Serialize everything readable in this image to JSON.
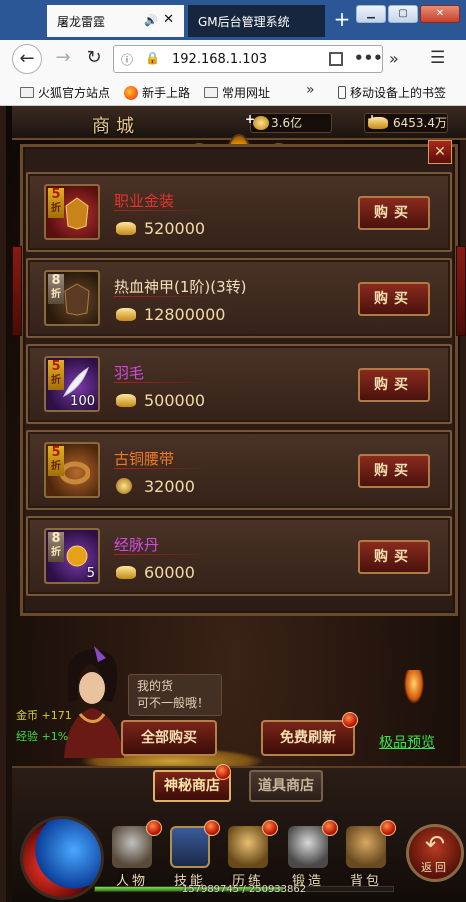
{
  "browser": {
    "tabs": [
      {
        "title": "屠龙雷霆",
        "active": true
      },
      {
        "title": "GM后台管理系统",
        "active": false
      }
    ],
    "url": "192.168.1.103",
    "bookmarks": [
      "火狐官方站点",
      "新手上路",
      "常用网址",
      "移动设备上的书签"
    ]
  },
  "game": {
    "title": "商城",
    "gold_amount": "3.6亿",
    "ingot_amount": "6453.4万",
    "items": [
      {
        "name": "职业金装",
        "price": "520000",
        "discount_num": "5",
        "discount_char": "折",
        "qty": "",
        "name_color": "#e6322a",
        "rarity": "red",
        "currency": "ingot"
      },
      {
        "name": "热血神甲(1阶)(3转)",
        "price": "12800000",
        "discount_num": "8",
        "discount_char": "折",
        "qty": "",
        "name_color": "#f0e0b8",
        "rarity": "brown",
        "currency": "ingot"
      },
      {
        "name": "羽毛",
        "price": "500000",
        "discount_num": "5",
        "discount_char": "折",
        "qty": "100",
        "name_color": "#d04ae0",
        "rarity": "purple",
        "currency": "ingot"
      },
      {
        "name": "古铜腰带",
        "price": "32000",
        "discount_num": "5",
        "discount_char": "折",
        "qty": "",
        "name_color": "#f07a22",
        "rarity": "orange",
        "currency": "coin"
      },
      {
        "name": "经脉丹",
        "price": "60000",
        "discount_num": "8",
        "discount_char": "折",
        "qty": "5",
        "name_color": "#d04ae0",
        "rarity": "purple",
        "currency": "ingot"
      }
    ],
    "buy_label": "购买",
    "npc_speech_line1": "我的货",
    "npc_speech_line2": "可不一般哦！",
    "buy_all_label": "全部购买",
    "free_refresh_label": "免费刷新",
    "preview_label": "极品预览",
    "gold_note": "金币 +171",
    "exp_note": "经验 +1%",
    "tab_mystery": "神秘商店",
    "tab_props": "道具商店",
    "dock": [
      "人物",
      "技能",
      "历练",
      "锻造",
      "背包"
    ],
    "return_label": "返回",
    "exp_text": "157989745 / 250933862",
    "exp_fraction": 0.63
  }
}
